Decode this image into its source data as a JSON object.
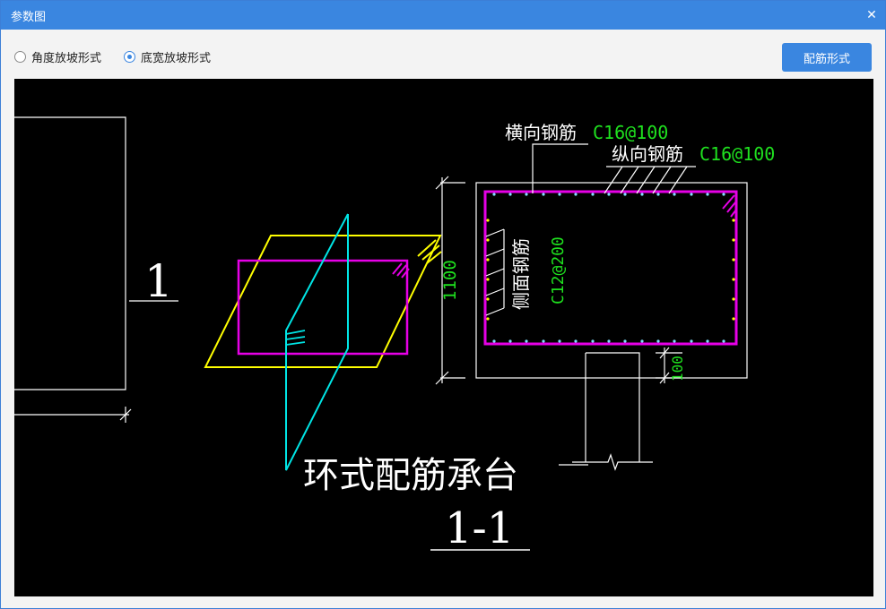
{
  "window": {
    "title": "参数图",
    "close_icon": "close-icon"
  },
  "options": {
    "radio1": {
      "label": "角度放坡形式",
      "checked": false
    },
    "radio2": {
      "label": "底宽放坡形式",
      "checked": true
    },
    "rebar_button": "配筋形式"
  },
  "drawing": {
    "section_marker": "1",
    "title": "环式配筋承台",
    "section_label": "1-1",
    "transverse_label": "横向钢筋",
    "transverse_value": "C16@100",
    "longitudinal_label": "纵向钢筋",
    "longitudinal_value": "C16@100",
    "side_label": "侧面钢筋",
    "side_value": "C12@200",
    "height_dim": "1100",
    "embed_dim": "100"
  },
  "colors": {
    "accent": "#3a86e0",
    "cad_background": "#000000",
    "cad_white": "#ffffff",
    "cad_green": "#1fe01f",
    "cad_magenta": "#e600e6",
    "cad_yellow": "#ffff00",
    "cad_cyan": "#00e5e5"
  }
}
